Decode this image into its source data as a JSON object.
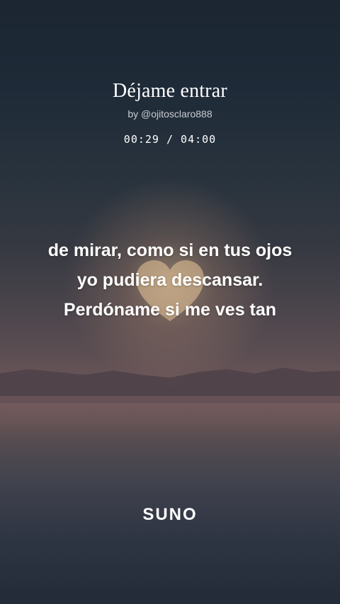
{
  "song": {
    "title": "Déjame entrar",
    "byline": "by @ojitosclaro888",
    "time": "00:29 / 04:00"
  },
  "lyrics": {
    "lines": [
      "de mirar, como si en tus ojos",
      "yo pudiera descansar.",
      "Perdóname si me ves tan"
    ]
  },
  "brand": {
    "logo_text": "SUNO"
  }
}
